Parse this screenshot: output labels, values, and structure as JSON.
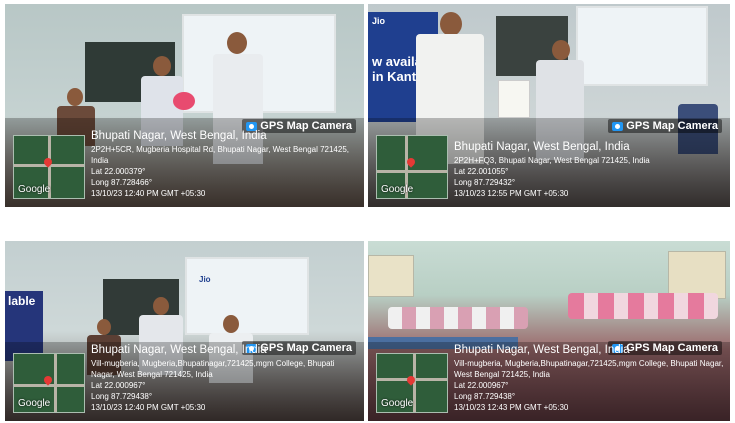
{
  "badge_label": "GPS Map Camera",
  "map_logo": "Google",
  "colors": {
    "overlay": "#000000",
    "badge_icon": "#2196f3",
    "pin": "#e53935"
  },
  "photos": [
    {
      "location": "Bhupati Nagar, West Bengal, India",
      "address": "2P2H+5CR, Mugberia Hospital Rd, Bhupati Nagar, West Bengal 721425, India",
      "lat": "Lat 22.000379°",
      "long": "Long 87.728466°",
      "datetime": "13/10/23 12:40 PM GMT +05:30"
    },
    {
      "location": "Bhupati Nagar, West Bengal, India",
      "address": "2P2H+FQ3, Bhupati Nagar, West Bengal 721425, India",
      "lat": "Lat 22.001055°",
      "long": "Long 87.729432°",
      "datetime": "13/10/23 12:55 PM GMT +05:30",
      "banner_text": "w availa in Kanth",
      "logo_text": "Jio"
    },
    {
      "location": "Bhupati Nagar, West Bengal, India",
      "address": "Vill-mugberia, Mugberia,Bhupatinagar,721425,mgm College, Bhupati Nagar, West Bengal 721425, India",
      "lat": "Lat 22.000967°",
      "long": "Long 87.729438°",
      "datetime": "13/10/23 12:40 PM GMT +05:30",
      "banner_text": "lable",
      "logo_text": "Jio"
    },
    {
      "location": "Bhupati Nagar, West Bengal, India",
      "address": "Vill-mugberia, Mugberia,Bhupatinagar,721425,mgm College, Bhupati Nagar, West Bengal 721425, India",
      "lat": "Lat 22.000967°",
      "long": "Long 87.729438°",
      "datetime": "13/10/23 12:43 PM GMT +05:30"
    }
  ]
}
